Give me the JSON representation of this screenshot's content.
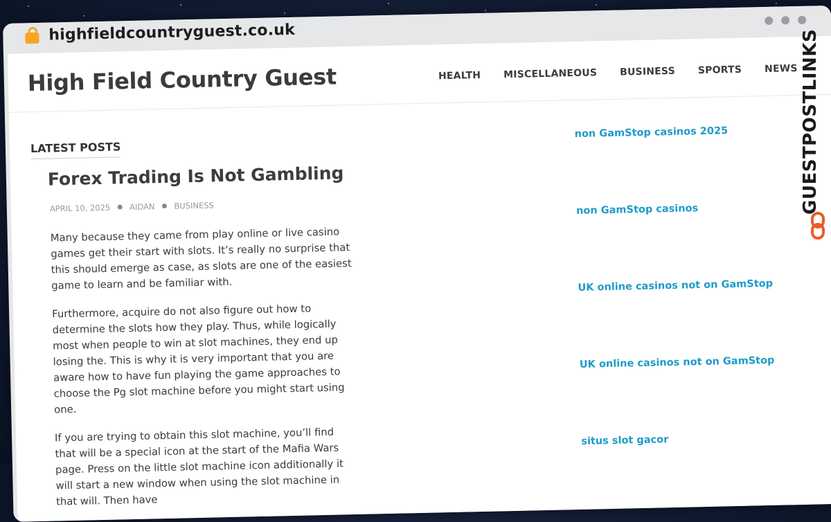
{
  "browser": {
    "url": "highfieldcountryguest.co.uk"
  },
  "site": {
    "title": "High Field Country Guest",
    "nav": [
      "HEALTH",
      "MISCELLANEOUS",
      "BUSINESS",
      "SPORTS",
      "NEWS"
    ]
  },
  "main": {
    "section_label": "LATEST POSTS",
    "post": {
      "title": "Forex Trading Is Not Gambling",
      "date": "APRIL 10, 2025",
      "author": "AIDAN",
      "category": "BUSINESS",
      "paragraphs": [
        "Many because they came from play online or live casino games get their start with slots. It’s really no surprise that this should emerge as case, as slots are one of the easiest game to learn and be familiar with.",
        "Furthermore, acquire do not also figure out how to determine the slots how they play. Thus, while logically most when people to win at slot machines, they end up losing the. This is why it is very important that you are aware how to have fun playing the game approaches to choose the Pg slot machine before you might start using one.",
        "If you are trying to obtain this slot machine, you’ll find that will be a special icon at the start of the Mafia Wars page. Press on the little slot machine icon additionally it will start a new window when using the slot machine in that will. Then have"
      ]
    }
  },
  "sidebar": {
    "links": [
      "non GamStop casinos 2025",
      "non GamStop casinos",
      "UK online casinos not on GamStop",
      "UK online casinos not on GamStop",
      "situs slot gacor"
    ]
  },
  "watermark": {
    "text": "GUESTPOSTLINKS"
  },
  "colors": {
    "link": "#1e9bc9",
    "accent_logo": "#f05a28",
    "background": "#111a30"
  }
}
